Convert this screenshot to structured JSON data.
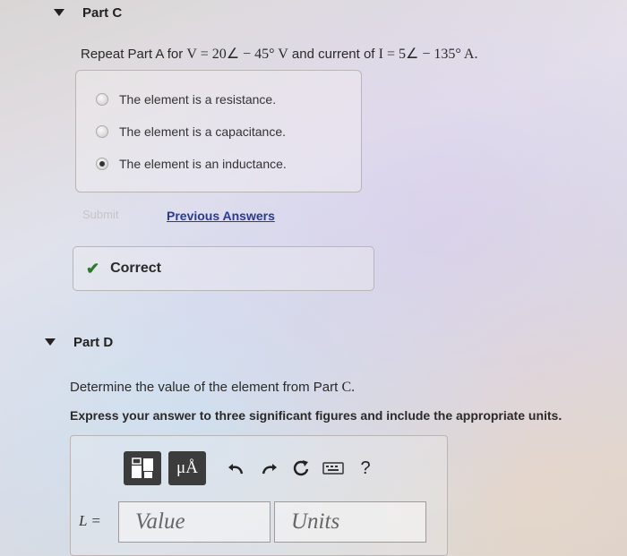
{
  "part_c": {
    "title": "Part C",
    "question_prefix": "Repeat Part A for",
    "question_v": "V = 20∠ − 45° V",
    "question_mid": "and current of",
    "question_i": "I = 5∠ − 135° A.",
    "choices": [
      {
        "label": "The element is a resistance.",
        "selected": false
      },
      {
        "label": "The element is a capacitance.",
        "selected": false
      },
      {
        "label": "The element is an inductance.",
        "selected": true
      }
    ],
    "submit_label": "Submit",
    "previous_answers_label": "Previous Answers",
    "result_label": "Correct"
  },
  "part_d": {
    "title": "Part D",
    "question_prefix": "Determine the value of the element from Part",
    "question_ref": "C.",
    "instruction": "Express your answer to three significant figures and include the appropriate units.",
    "toolbar": {
      "units_label": "μÅ",
      "help_label": "?"
    },
    "field_label": "L =",
    "value_placeholder": "Value",
    "units_placeholder": "Units"
  },
  "icons": [
    "collapse-triangle-icon",
    "checkmark-icon",
    "templates-icon",
    "units-icon",
    "undo-icon",
    "redo-icon",
    "reset-icon",
    "keyboard-icon",
    "help-icon"
  ],
  "colors": {
    "link": "#2a3b8f",
    "correct": "#2c7a2c",
    "toolbar_button": "#3c3c3c"
  }
}
